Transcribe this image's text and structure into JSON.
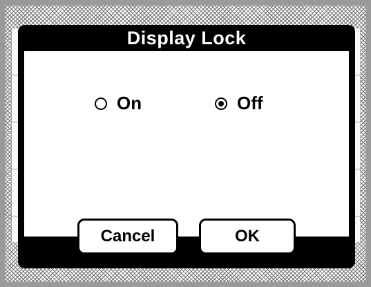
{
  "dialog": {
    "title": "Display Lock",
    "options": [
      {
        "label": "On",
        "selected": false
      },
      {
        "label": "Off",
        "selected": true
      }
    ],
    "buttons": {
      "cancel_label": "Cancel",
      "ok_label": "OK"
    }
  },
  "colors": {
    "dialog_frame": "#000000",
    "dialog_bg": "#ffffff",
    "outer_frame": "#9a9a9a"
  }
}
